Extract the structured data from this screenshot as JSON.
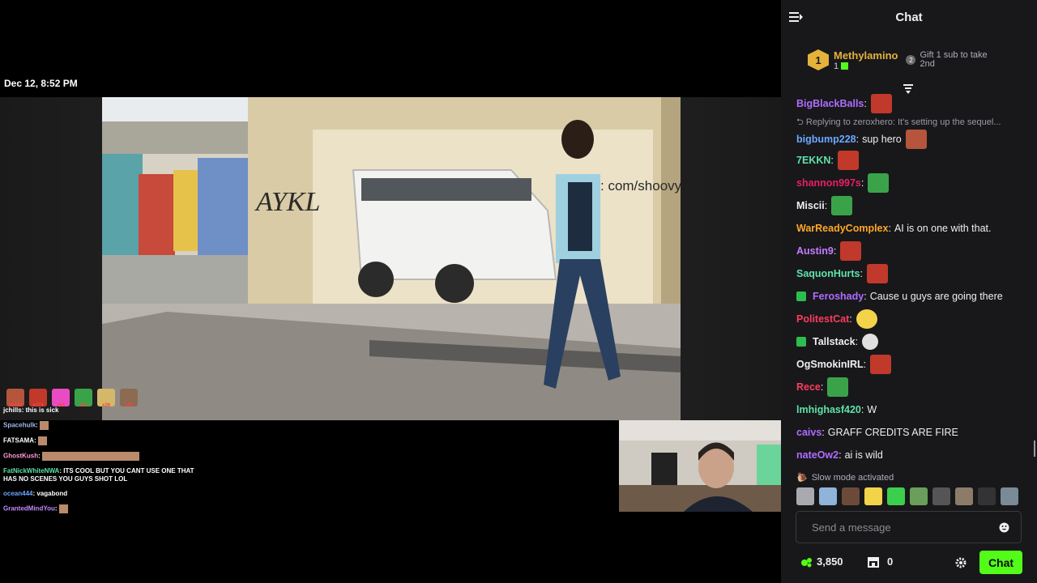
{
  "stream": {
    "timestamp": "Dec 12, 8:52 PM",
    "emote_strip": [
      {
        "count": "x1016",
        "color": "#b5553c"
      },
      {
        "count": "x374",
        "color": "#c0392b"
      },
      {
        "count": "x65",
        "color": "#e94cc2"
      },
      {
        "count": "x61",
        "color": "#3aa34a"
      },
      {
        "count": "x26",
        "color": "#d4b86a"
      },
      {
        "count": "x20",
        "color": "#8d6a52"
      }
    ],
    "overlay_chat": [
      {
        "user": "jchills",
        "text": ": this is sick",
        "color": "#ffffff"
      },
      {
        "user": "Spacehulk",
        "text": ":",
        "color": "#9fb7e8"
      },
      {
        "user": "FATSAMA",
        "text": ":",
        "color": "#ffffff"
      },
      {
        "user": "GhostKush",
        "text": ":",
        "color": "#ff9ad5"
      },
      {
        "user": "FatNickWhiteNWA",
        "text": ": ITS COOL BUT YOU CANT USE ONE THAT HAS NO SCENES YOU GUYS SHOT LOL",
        "color": "#5de3a8"
      },
      {
        "user": "ocean444",
        "text": ": vagabond",
        "color": "#6aa9ff"
      },
      {
        "user": "GrantedMindYou",
        "text": ":",
        "color": "#c48bff"
      }
    ],
    "graffiti_text": "vy: com/shoovy"
  },
  "chat": {
    "title": "Chat",
    "pinned": {
      "rank": "1",
      "gifter_name": "Methylamino",
      "gifter_count": "1",
      "next_rank": "2",
      "gift_prompt": "Gift 1 sub to take 2nd"
    },
    "reply_text": "Replying to zeroxhero: It's setting up the sequel...",
    "messages": [
      {
        "user": "BigBlackBalls",
        "text": "",
        "color": "#b06cff",
        "emote": "#c0392b"
      },
      {
        "user": "bigbump228",
        "text": "sup hero",
        "color": "#6aa9ff",
        "emote": "#b5553c"
      },
      {
        "user": "7EKKN",
        "text": "",
        "color": "#5de3a8",
        "emote": "#c0392b"
      },
      {
        "user": "shannon997s",
        "text": "",
        "color": "#e91e63",
        "emote": "#3aa34a"
      },
      {
        "user": "Miscii",
        "text": "",
        "color": "#efeff1",
        "emote": "#3aa34a"
      },
      {
        "user": "WarReadyComplex",
        "text": "AI is on one with that.",
        "color": "#ffa726",
        "emote": ""
      },
      {
        "user": "Austin9",
        "text": "",
        "color": "#c77dff",
        "emote": "#c0392b"
      },
      {
        "user": "SaquonHurts",
        "text": "",
        "color": "#5de3a8",
        "emote": "#c0392b"
      },
      {
        "user": "Feroshady",
        "text": "Cause u guys are going there",
        "color": "#b06cff",
        "emote": "",
        "badge": true
      },
      {
        "user": "PolitestCat",
        "text": "",
        "color": "#ff3b5c",
        "emote": "#f3d34a"
      },
      {
        "user": "Tallstack",
        "text": "",
        "color": "#efeff1",
        "emote": "#e0e0e0",
        "badge": true
      },
      {
        "user": "OgSmokinIRL",
        "text": "",
        "color": "#efeff1",
        "emote": "#c0392b"
      },
      {
        "user": "Rece",
        "text": "",
        "color": "#ff3b5c",
        "emote": "#3aa34a"
      },
      {
        "user": "lmhighasf420",
        "text": "W",
        "color": "#5de3a8",
        "emote": ""
      },
      {
        "user": "caivs",
        "text": "GRAFF CREDITS ARE FIRE",
        "color": "#b06cff",
        "emote": ""
      },
      {
        "user": "nateOw2",
        "text": "ai is wild",
        "color": "#b06cff",
        "emote": ""
      }
    ],
    "slow_mode": "Slow mode activated",
    "emote_picker": [
      "#a9a9b0",
      "#8fb3d9",
      "#6b4a3a",
      "#f3d34a",
      "#3ccf4e",
      "#6b9e5a",
      "#555555",
      "#8d7b6a",
      "#333333",
      "#7a8a96"
    ],
    "input_placeholder": "Send a message",
    "points": "3,850",
    "store_count": "0",
    "send_label": "Chat"
  },
  "colors": {
    "accent": "#53fc18",
    "gold": "#e5b23a",
    "panel": "#18181b"
  }
}
